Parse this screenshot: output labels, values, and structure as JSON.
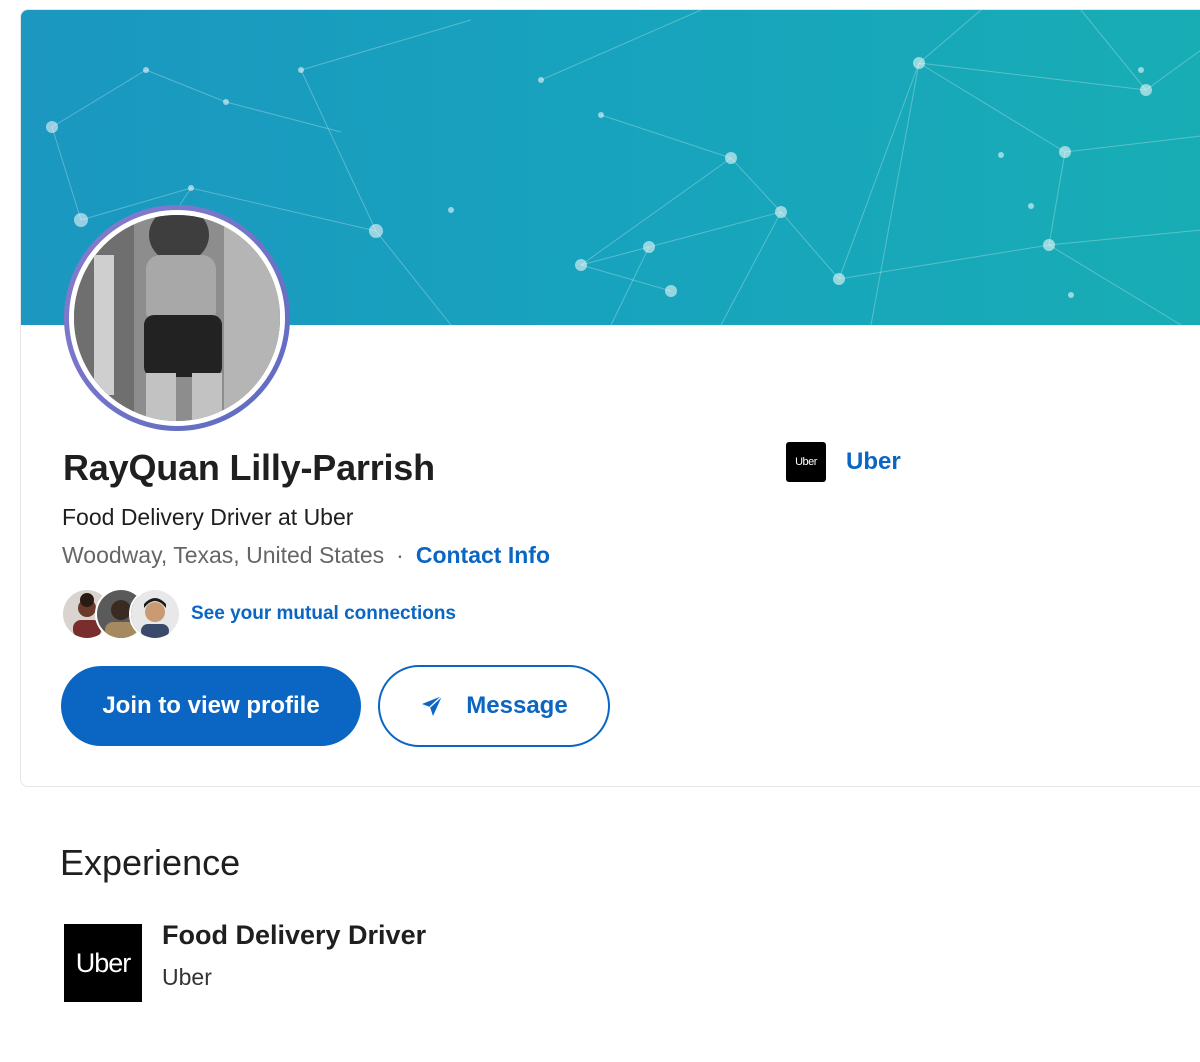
{
  "profile": {
    "name": "RayQuan Lilly-Parrish",
    "headline": "Food Delivery Driver at Uber",
    "location": "Woodway, Texas, United States",
    "separator": "·",
    "contact_info_label": "Contact Info",
    "mutual_connections_label": "See your mutual connections",
    "avatar_icon": "profile-photo",
    "mutual_faces": [
      "person-avatar",
      "person-avatar",
      "person-avatar"
    ]
  },
  "actions": {
    "join_label": "Join to view profile",
    "message_label": "Message",
    "message_icon": "send-icon"
  },
  "current_company": {
    "logo_text": "Uber",
    "name": "Uber"
  },
  "experience": {
    "section_title": "Experience",
    "items": [
      {
        "logo_text": "Uber",
        "title": "Food Delivery Driver",
        "company": "Uber"
      }
    ]
  },
  "colors": {
    "brand_blue": "#0a66c2",
    "banner_start": "#1b97c0",
    "banner_end": "#18adb5",
    "text_primary": "#1f1f1f",
    "text_secondary": "#666666"
  }
}
